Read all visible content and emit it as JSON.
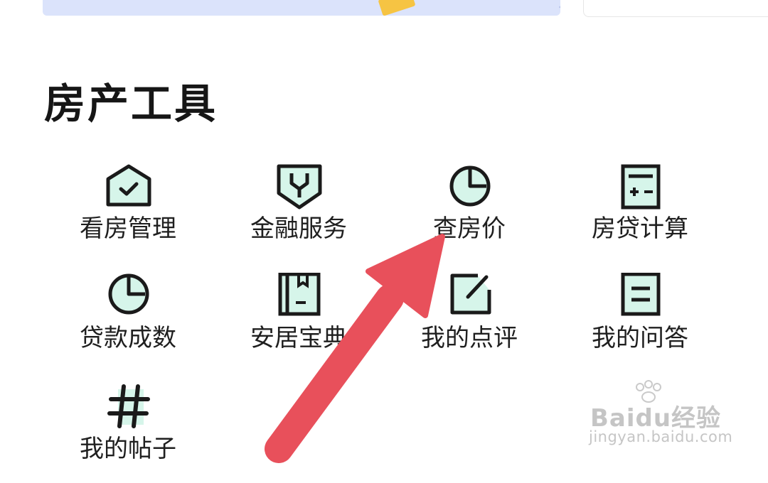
{
  "section": {
    "title": "房产工具"
  },
  "tools": [
    {
      "label": "看房管理"
    },
    {
      "label": "金融服务"
    },
    {
      "label": "查房价"
    },
    {
      "label": "房贷计算"
    },
    {
      "label": "贷款成数"
    },
    {
      "label": "安居宝典"
    },
    {
      "label": "我的点评"
    },
    {
      "label": "我的问答"
    },
    {
      "label": "我的帖子"
    }
  ],
  "watermark": {
    "main": "Baidu经验",
    "sub": "jingyan.baidu.com"
  },
  "colors": {
    "icon_fill": "#d6f5ea",
    "icon_stroke": "#1a1a1a",
    "arrow": "#e8505b",
    "banner": "#dbe3fb"
  }
}
